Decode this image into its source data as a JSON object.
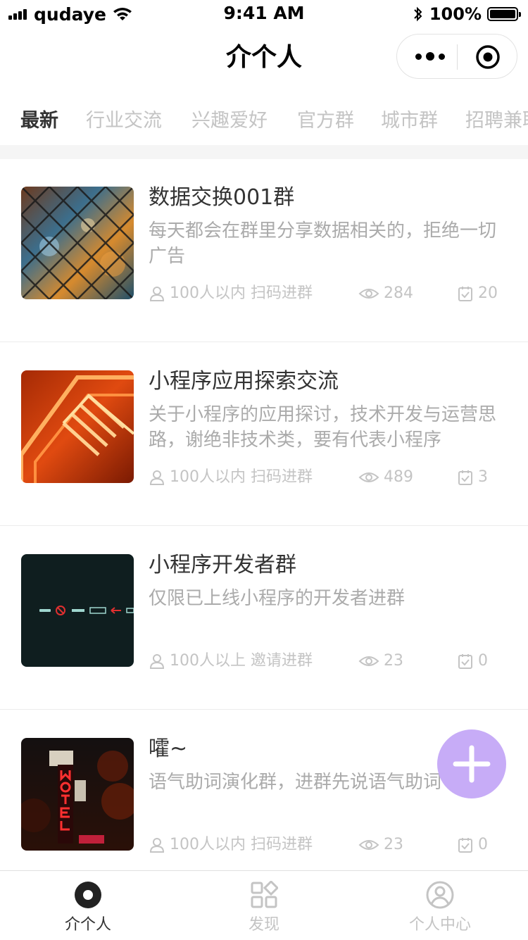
{
  "status_bar": {
    "carrier": "qudaye",
    "time": "9:41 AM",
    "battery": "100%"
  },
  "nav": {
    "title": "介个人"
  },
  "categories": [
    {
      "label": "最新",
      "active": true
    },
    {
      "label": "行业交流",
      "active": false
    },
    {
      "label": "兴趣爱好",
      "active": false
    },
    {
      "label": "官方群",
      "active": false
    },
    {
      "label": "城市群",
      "active": false
    },
    {
      "label": "招聘兼职",
      "active": false
    }
  ],
  "groups": [
    {
      "title": "数据交换001群",
      "desc": "每天都会在群里分享数据相关的，拒绝一切广告",
      "size": "100人以内",
      "join": "扫码进群",
      "views": "284",
      "count": "20",
      "thumb": "chain-link-fence-photo"
    },
    {
      "title": "小程序应用探索交流",
      "desc": "关于小程序的应用探讨，技术开发与运营思路，谢绝非技术类，要有代表小程序",
      "size": "100人以内",
      "join": "扫码进群",
      "views": "489",
      "count": "3",
      "thumb": "neon-staircase-photo"
    },
    {
      "title": "小程序开发者群",
      "desc": "仅限已上线小程序的开发者进群",
      "size": "100人以上",
      "join": "邀请进群",
      "views": "23",
      "count": "0",
      "thumb": "dark-sign-icons-photo"
    },
    {
      "title": "嚯~",
      "desc": "语气助词演化群，进群先说语气助词",
      "size": "100人以内",
      "join": "扫码进群",
      "views": "23",
      "count": "0",
      "thumb": "motel-neon-sign-photo"
    }
  ],
  "tabbar": {
    "items": [
      {
        "label": "介个人",
        "icon": "home-circle-icon",
        "active": true
      },
      {
        "label": "发现",
        "icon": "grid-discover-icon",
        "active": false
      },
      {
        "label": "个人中心",
        "icon": "user-profile-icon",
        "active": false
      }
    ]
  },
  "colors": {
    "fab": "#c5a8f7",
    "muted_text": "#c4c4c4",
    "desc_text": "#ababab",
    "title_text": "#333333"
  }
}
